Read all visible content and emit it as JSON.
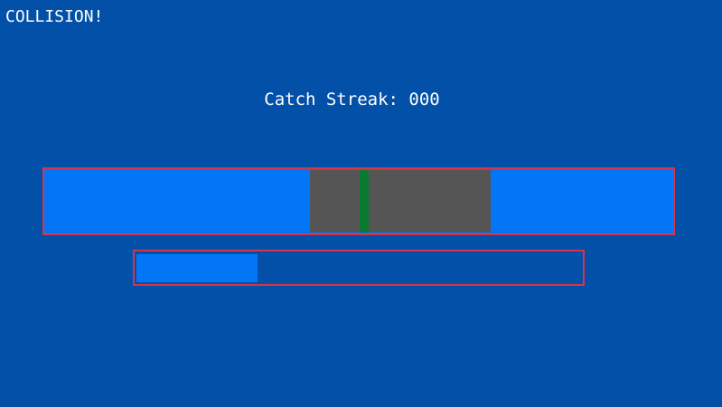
{
  "hud": {
    "status_text": "COLLISION!",
    "streak_label": "Catch Streak:",
    "streak_value": "000"
  },
  "catch_bar": {
    "zone_start": 0.423,
    "zone_end": 0.71,
    "marker_position": 0.502
  },
  "progress": {
    "fill_fraction": 0.27
  },
  "colors": {
    "background": "#0250a8",
    "track": "#0276f6",
    "zone": "#555555",
    "marker": "#0a7a32",
    "border": "#d8344a"
  }
}
